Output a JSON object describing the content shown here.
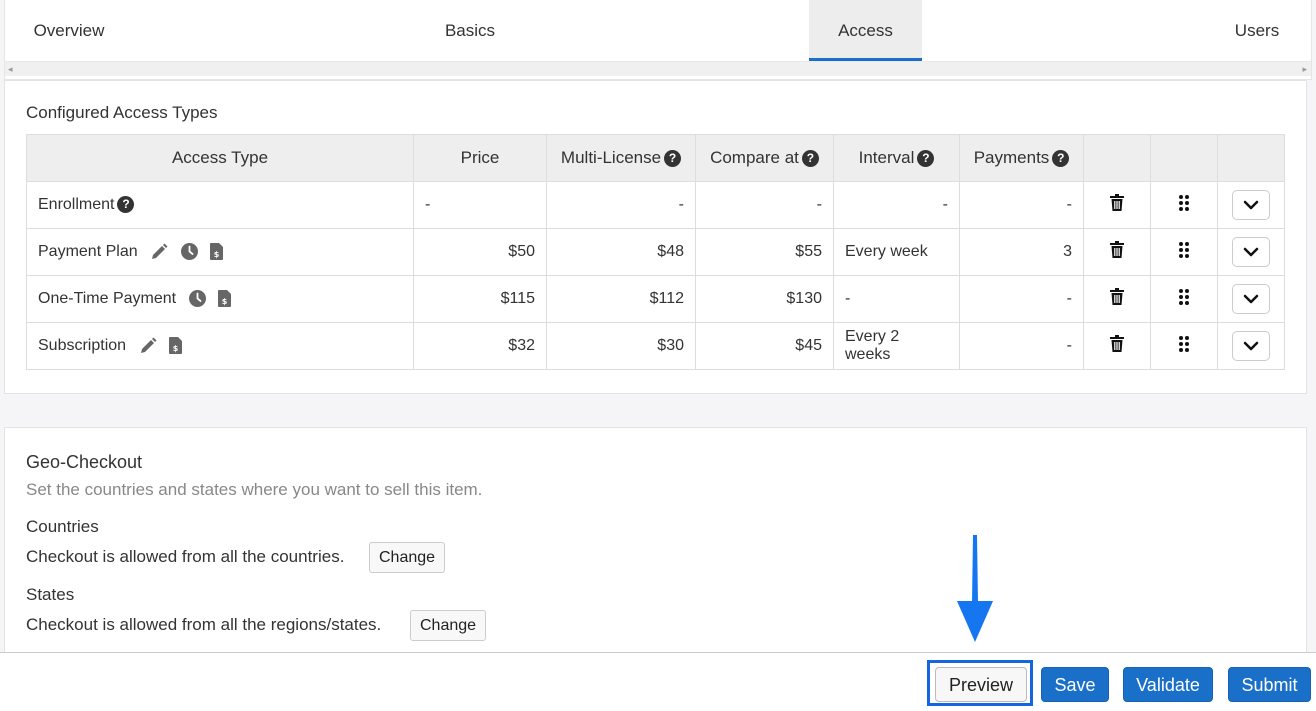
{
  "tabs": [
    {
      "label": "Overview",
      "active": false
    },
    {
      "label": "Basics",
      "active": false
    },
    {
      "label": "Access",
      "active": true
    },
    {
      "label": "Users",
      "active": false
    }
  ],
  "access_section": {
    "title": "Configured Access Types",
    "columns": [
      "Access Type",
      "Price",
      "Multi-License",
      "Compare at",
      "Interval",
      "Payments"
    ],
    "rows": [
      {
        "name": "Enrollment",
        "price": "-",
        "multi_license": "-",
        "compare_at": "-",
        "interval": "-",
        "payments": "-",
        "icons": [
          "help-icon"
        ]
      },
      {
        "name": "Payment Plan",
        "price": "$50",
        "multi_license": "$48",
        "compare_at": "$55",
        "interval": "Every week",
        "payments": "3",
        "icons": [
          "pencil-icon",
          "clock-icon",
          "invoice-dollar-icon"
        ]
      },
      {
        "name": "One-Time Payment",
        "price": "$115",
        "multi_license": "$112",
        "compare_at": "$130",
        "interval": "-",
        "payments": "-",
        "icons": [
          "clock-icon",
          "invoice-dollar-icon"
        ]
      },
      {
        "name": "Subscription",
        "price": "$32",
        "multi_license": "$30",
        "compare_at": "$45",
        "interval": "Every 2 weeks",
        "payments": "-",
        "icons": [
          "pencil-icon",
          "invoice-dollar-icon"
        ]
      }
    ],
    "help_glyph": "?"
  },
  "geo": {
    "title": "Geo-Checkout",
    "subtitle": "Set the countries and states where you want to sell this item.",
    "countries_label": "Countries",
    "countries_text": "Checkout is allowed from all the countries.",
    "states_label": "States",
    "states_text": "Checkout is allowed from all the regions/states.",
    "change_label": "Change"
  },
  "footer": {
    "preview": "Preview",
    "save": "Save",
    "validate": "Validate",
    "submit": "Submit"
  },
  "colors": {
    "accent": "#1a6fc9",
    "highlight": "#1565e0"
  }
}
